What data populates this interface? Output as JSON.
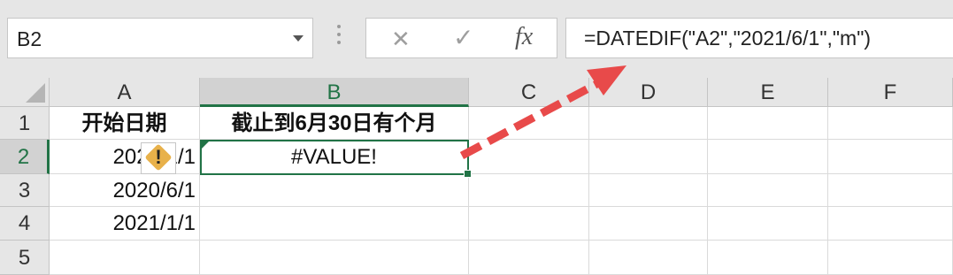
{
  "name_box": {
    "value": "B2"
  },
  "formula_bar": {
    "cancel_glyph": "✕",
    "enter_glyph": "✓",
    "fx_label": "fx",
    "formula": "=DATEDIF(\"A2\",\"2021/6/1\",\"m\")"
  },
  "columns": [
    "A",
    "B",
    "C",
    "D",
    "E",
    "F"
  ],
  "rows": [
    "1",
    "2",
    "3",
    "4",
    "5"
  ],
  "cells": {
    "A1": "开始日期",
    "B1": "截止到6月30日有个月",
    "A2": "2020/1/1",
    "B2": "#VALUE!",
    "A3": "2020/6/1",
    "A4": "2021/1/1"
  },
  "error_indicator": {
    "glyph": "!"
  },
  "colors": {
    "accent": "#217346",
    "arrow": "#e84a4a",
    "warning": "#e8b14a"
  }
}
